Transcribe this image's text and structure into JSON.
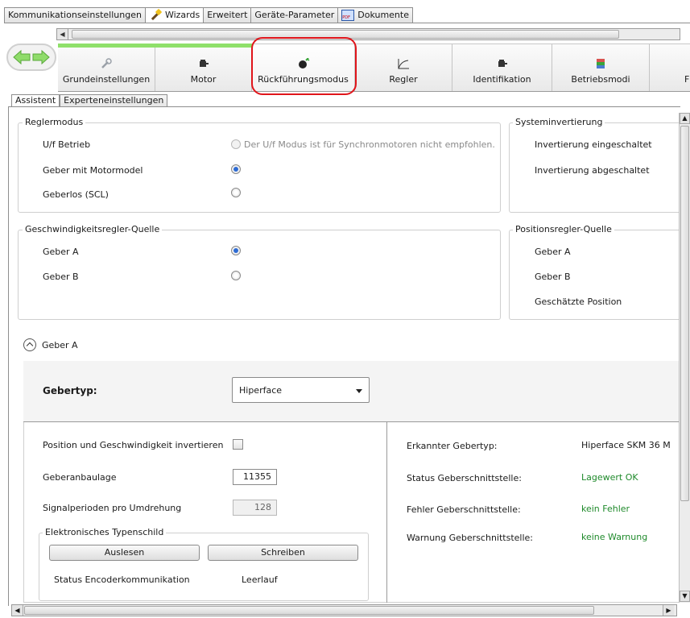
{
  "top_tabs": [
    {
      "label": "Kommunikationseinstellungen"
    },
    {
      "label": "Wizards",
      "icon": "wand-icon"
    },
    {
      "label": "Erweitert"
    },
    {
      "label": "Geräte-Parameter"
    },
    {
      "label": "Dokumente",
      "icon": "document-icon"
    }
  ],
  "ribbon": {
    "progress_color": "#8fe06a",
    "tabs": [
      {
        "label": "Grundeinstellungen",
        "icon": "wrench-icon"
      },
      {
        "label": "Motor",
        "icon": "motor-icon"
      },
      {
        "label": "Rückführungsmodus",
        "icon": "encoder-icon"
      },
      {
        "label": "Regler",
        "icon": "curve-icon"
      },
      {
        "label": "Identifikation",
        "icon": "motor-icon"
      },
      {
        "label": "Betriebsmodi",
        "icon": "modes-icon"
      },
      {
        "label": "F",
        "icon": ""
      }
    ],
    "highlight_color": "#e0151b"
  },
  "sub_tabs": [
    {
      "label": "Assistent"
    },
    {
      "label": "Experteneinstellungen"
    }
  ],
  "reglermodus": {
    "title": "Reglermodus",
    "options": [
      {
        "label": "U/f Betrieb",
        "hint": "Der U/f Modus ist für Synchronmotoren nicht empfohlen.",
        "checked": false,
        "disabled": true
      },
      {
        "label": "Geber mit Motormodel",
        "checked": true
      },
      {
        "label": "Geberlos (SCL)",
        "checked": false
      }
    ]
  },
  "systeminvertierung": {
    "title": "Systeminvertierung",
    "options": [
      "Invertierung eingeschaltet",
      "Invertierung abgeschaltet"
    ]
  },
  "geschwindigkeit": {
    "title": "Geschwindigkeitsregler-Quelle",
    "options": [
      {
        "label": "Geber A",
        "checked": true
      },
      {
        "label": "Geber B",
        "checked": false
      }
    ]
  },
  "positionsregler": {
    "title": "Positionsregler-Quelle",
    "options": [
      "Geber A",
      "Geber B",
      "Geschätzte Position"
    ]
  },
  "geber_a": {
    "header": "Geber A",
    "gebertyp_label": "Gebertyp:",
    "gebertyp_value": "Hiperface",
    "invert_label": "Position und Geschwindigkeit invertieren",
    "invert_checked": false,
    "anbaulage_label": "Geberanbaulage",
    "anbaulage_value": "11355",
    "signalperioden_label": "Signalperioden pro Umdrehung",
    "signalperioden_value": "128",
    "typenschild_title": "Elektronisches Typenschild",
    "btn_auslesen": "Auslesen",
    "btn_schreiben": "Schreiben",
    "status_kommunikation_label": "Status Encoderkommunikation",
    "status_kommunikation_value": "Leerlauf",
    "erkannt_label": "Erkannter Gebertyp:",
    "erkannt_value": "Hiperface SKM 36 M",
    "status_schnitt_label": "Status Geberschnittstelle:",
    "status_schnitt_value": "Lagewert OK",
    "fehler_label": "Fehler Geberschnittstelle:",
    "fehler_value": "kein Fehler",
    "warnung_label": "Warnung Geberschnittstelle:",
    "warnung_value": "keine Warnung",
    "status_color": "#1f8a2b"
  }
}
